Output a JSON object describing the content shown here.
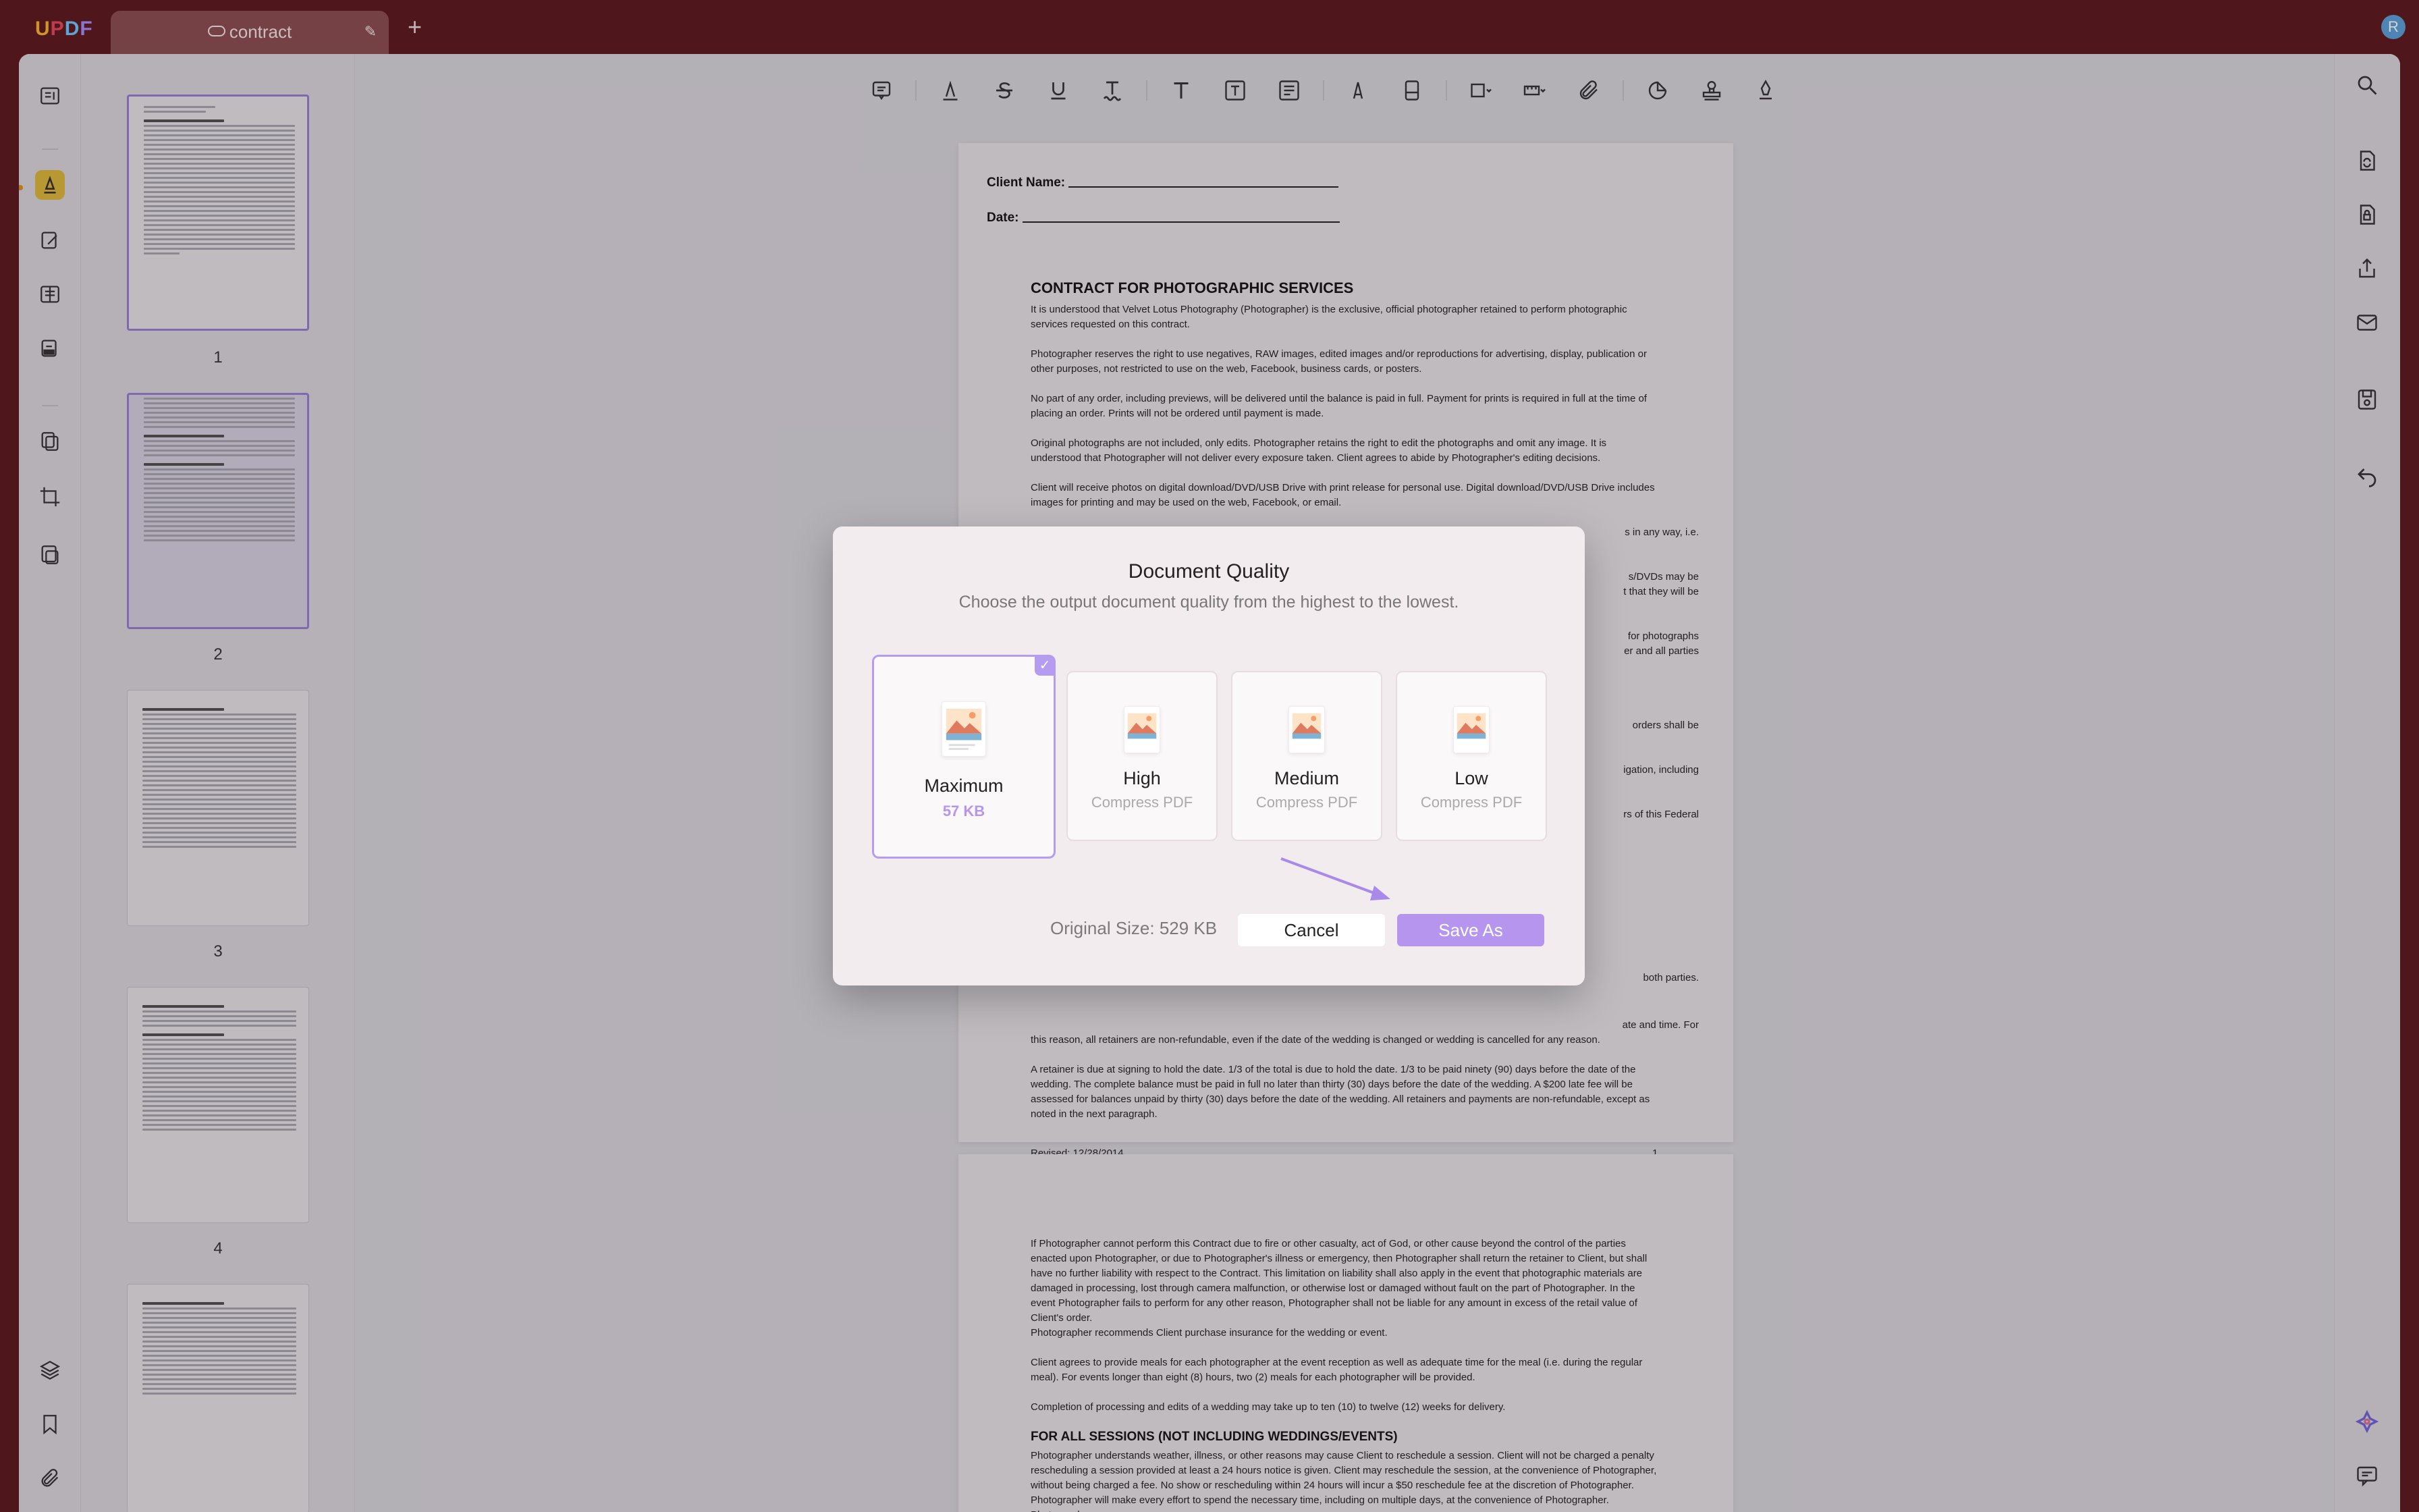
{
  "app": {
    "logo": "UPDF",
    "user_initial": "R"
  },
  "tab": {
    "title": "contract"
  },
  "thumbnails": [
    {
      "page": "1"
    },
    {
      "page": "2"
    },
    {
      "page": "3"
    },
    {
      "page": "4"
    }
  ],
  "document": {
    "client_name_label": "Client Name:",
    "date_label": "Date:",
    "heading": "CONTRACT FOR PHOTOGRAPHIC SERVICES",
    "paragraphs": [
      "It is understood that Velvet Lotus Photography (Photographer) is the exclusive, official photographer retained to perform photographic services requested on this contract.",
      "Photographer reserves the right to use negatives, RAW images, edited images and/or reproductions for advertising, display, publication or other purposes, not restricted to use on the web, Facebook, business cards, or posters.",
      "No part of any order, including previews, will be delivered until the balance is paid in full. Payment for prints is required in full at the time of placing an order. Prints will not be ordered until payment is made.",
      "Original photographs are not included, only edits. Photographer retains the right to edit the photographs and omit any image. It is understood that Photographer will not deliver every exposure taken. Client agrees to abide by Photographer's editing decisions.",
      "Client will receive photos on digital download/DVD/USB Drive with print release for personal use. Digital download/DVD/USB Drive includes images for printing and may be used on the web, Facebook, or email."
    ],
    "fragments": [
      "s in any way, i.e.",
      "s/DVDs may be",
      "t that they will be",
      "for photographs",
      "er and all parties",
      "orders shall be",
      "igation, including",
      "rs of this Federal",
      "both parties."
    ],
    "retainer_tail": "this reason, all retainers are non-refundable, even if the date of the wedding is changed or wedding is cancelled for any reason.",
    "retainer_tail_prefix": "ate and time. For",
    "retainer_para": "A retainer is due at signing to hold the date. 1/3 of the total is due to hold the date. 1/3 to be paid ninety (90) days before the date of the wedding. The complete balance must be paid in full no later than thirty (30) days before the date of the wedding. A $200 late fee will be assessed for balances unpaid by thirty (30) days before the date of the wedding. All retainers and payments are non-refundable, except as noted in the next paragraph.",
    "revised": "Revised: 12/28/2014",
    "page_number": "1",
    "page2_paragraphs": [
      "If Photographer cannot perform this Contract due to fire or other casualty, act of God, or other cause beyond the control of the parties enacted upon Photographer, or due to Photographer's illness or emergency, then Photographer shall return the retainer to Client, but shall have no further liability with respect to the Contract. This limitation on liability shall also apply in the event that photographic materials are damaged in processing, lost through camera malfunction, or otherwise lost or damaged without fault on the part of Photographer. In the event Photographer fails to perform for any other reason, Photographer shall not be liable for any amount in excess of the retail value of Client's order.",
      "Photographer recommends Client purchase insurance for the wedding or event.",
      "Client agrees to provide meals for each photographer at the event reception as well as adequate time for the meal (i.e. during the regular meal). For events longer than eight (8) hours, two (2) meals for each photographer will be provided.",
      "Completion of processing and edits of a wedding may take up to ten (10) to twelve (12) weeks for delivery."
    ],
    "page2_heading": "FOR ALL SESSIONS (NOT INCLUDING WEDDINGS/EVENTS)",
    "page2_last": "Photographer understands weather, illness, or other reasons may cause Client to reschedule a session. Client will not be charged a penalty rescheduling a session provided at least a 24 hours notice is given. Client may reschedule the session, at the convenience of Photographer, without being charged a fee. No show or rescheduling within 24 hours will incur a $50 reschedule fee at the discretion of Photographer. Photographer will make every effort to spend the necessary time, including on multiple days, at the convenience of Photographer. Photographer"
  },
  "dialog": {
    "title": "Document Quality",
    "subtitle": "Choose the output document quality from the highest to the lowest.",
    "options": [
      {
        "name": "Maximum",
        "sub": "57 KB",
        "selected": true
      },
      {
        "name": "High",
        "sub": "Compress PDF",
        "selected": false
      },
      {
        "name": "Medium",
        "sub": "Compress PDF",
        "selected": false
      },
      {
        "name": "Low",
        "sub": "Compress PDF",
        "selected": false
      }
    ],
    "original_size": "Original Size: 529 KB",
    "cancel_label": "Cancel",
    "save_label": "Save As",
    "accent": "#b695ee"
  }
}
